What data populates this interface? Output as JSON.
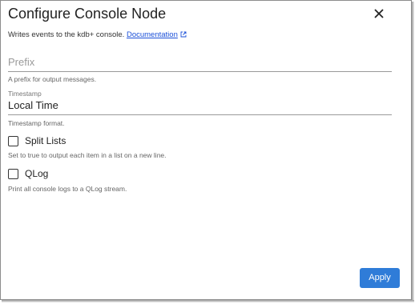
{
  "dialog": {
    "title": "Configure Console Node",
    "description": "Writes events to the kdb+ console.",
    "doc_link": "Documentation"
  },
  "fields": {
    "prefix": {
      "placeholder": "Prefix",
      "hint": "A prefix for output messages."
    },
    "timestamp": {
      "label": "Timestamp",
      "value": "Local Time",
      "hint": "Timestamp format."
    },
    "split_lists": {
      "label": "Split Lists",
      "checked": false,
      "hint": "Set to true to output each item in a list on a new line."
    },
    "qlog": {
      "label": "QLog",
      "checked": false,
      "hint": "Print all console logs to a QLog stream."
    }
  },
  "actions": {
    "apply_label": "Apply"
  },
  "colors": {
    "accent": "#2f7cd8",
    "link": "#1a4fd8"
  },
  "icons": {
    "close": "close-icon",
    "external_link": "external-link-icon"
  }
}
